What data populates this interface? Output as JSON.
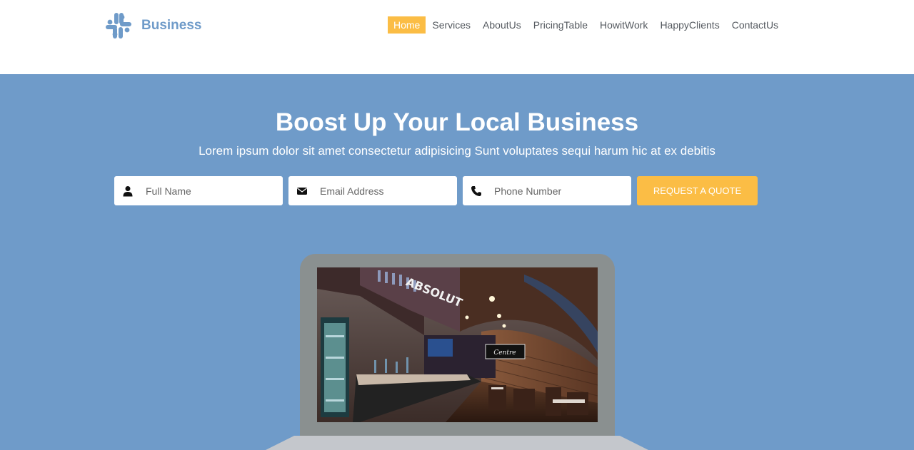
{
  "brand": {
    "name": "Business"
  },
  "nav": {
    "items": [
      {
        "label": "Home",
        "active": true
      },
      {
        "label": "Services",
        "active": false
      },
      {
        "label": "AboutUs",
        "active": false
      },
      {
        "label": "PricingTable",
        "active": false
      },
      {
        "label": "HowitWork",
        "active": false
      },
      {
        "label": "HappyClients",
        "active": false
      },
      {
        "label": "ContactUs",
        "active": false
      }
    ]
  },
  "hero": {
    "title": "Boost Up Your Local Business",
    "subtitle": "Lorem ipsum dolor sit amet consectetur adipisicing Sunt voluptates sequi harum hic at ex debitis"
  },
  "form": {
    "full_name": {
      "placeholder": "Full Name",
      "value": "",
      "icon": "user-icon"
    },
    "email": {
      "placeholder": "Email Address",
      "value": "",
      "icon": "envelope-icon"
    },
    "phone": {
      "placeholder": "Phone Number",
      "value": "",
      "icon": "phone-icon"
    },
    "submit_label": "REQUEST A QUOTE"
  },
  "mockup": {
    "sign_absolut": "ABSOLUT",
    "sign_neon": "Centre"
  },
  "colors": {
    "accent": "#fbbd45",
    "hero_bg": "#6f9bc9",
    "brand": "#6f9bc9",
    "nav_text": "#555a60"
  }
}
